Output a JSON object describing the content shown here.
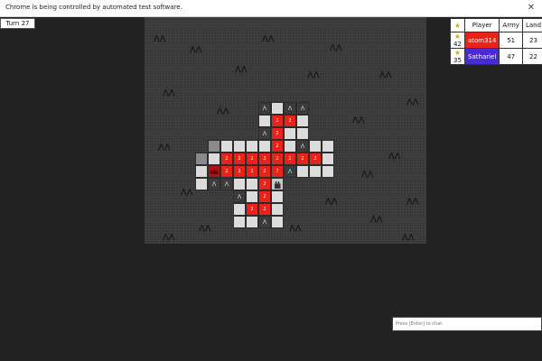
{
  "infobar": {
    "message": "Chrome is being controlled by automated test software.",
    "close_glyph": "✕"
  },
  "game": {
    "turn": "Turn 27",
    "board": {
      "colors": {
        "red": "#ea2218",
        "neutral": "#dcdcdc",
        "fog": "#3a3a3a",
        "general": "#b51010"
      },
      "tiles": [
        {
          "col": 5,
          "row": 0,
          "type": "mountain"
        },
        {
          "col": 6,
          "row": 0,
          "type": "neutral"
        },
        {
          "col": 7,
          "row": 0,
          "type": "mountain"
        },
        {
          "col": 8,
          "row": 0,
          "type": "mountain"
        },
        {
          "col": 5,
          "row": 1,
          "type": "neutral"
        },
        {
          "col": 6,
          "row": 1,
          "type": "red",
          "army": "2"
        },
        {
          "col": 7,
          "row": 1,
          "type": "red",
          "army": "2"
        },
        {
          "col": 8,
          "row": 1,
          "type": "neutral"
        },
        {
          "col": 5,
          "row": 2,
          "type": "mountain"
        },
        {
          "col": 6,
          "row": 2,
          "type": "red",
          "army": "2"
        },
        {
          "col": 7,
          "row": 2,
          "type": "neutral"
        },
        {
          "col": 8,
          "row": 2,
          "type": "neutral"
        },
        {
          "col": 1,
          "row": 3,
          "type": "dark"
        },
        {
          "col": 2,
          "row": 3,
          "type": "neutral"
        },
        {
          "col": 3,
          "row": 3,
          "type": "neutral"
        },
        {
          "col": 4,
          "row": 3,
          "type": "neutral"
        },
        {
          "col": 5,
          "row": 3,
          "type": "neutral"
        },
        {
          "col": 6,
          "row": 3,
          "type": "red",
          "army": "2"
        },
        {
          "col": 7,
          "row": 3,
          "type": "neutral"
        },
        {
          "col": 8,
          "row": 3,
          "type": "mountain"
        },
        {
          "col": 9,
          "row": 3,
          "type": "neutral"
        },
        {
          "col": 10,
          "row": 3,
          "type": "neutral"
        },
        {
          "col": 0,
          "row": 4,
          "type": "dark"
        },
        {
          "col": 1,
          "row": 4,
          "type": "neutral"
        },
        {
          "col": 2,
          "row": 4,
          "type": "red",
          "army": "2"
        },
        {
          "col": 3,
          "row": 4,
          "type": "red",
          "army": "2"
        },
        {
          "col": 4,
          "row": 4,
          "type": "red",
          "army": "2"
        },
        {
          "col": 5,
          "row": 4,
          "type": "red",
          "army": "2"
        },
        {
          "col": 6,
          "row": 4,
          "type": "red",
          "army": "2"
        },
        {
          "col": 7,
          "row": 4,
          "type": "red",
          "army": "2"
        },
        {
          "col": 8,
          "row": 4,
          "type": "red",
          "army": "2"
        },
        {
          "col": 9,
          "row": 4,
          "type": "red",
          "army": "2"
        },
        {
          "col": 10,
          "row": 4,
          "type": "neutral"
        },
        {
          "col": 0,
          "row": 5,
          "type": "neutral"
        },
        {
          "col": 1,
          "row": 5,
          "type": "general"
        },
        {
          "col": 2,
          "row": 5,
          "type": "red",
          "army": "2"
        },
        {
          "col": 3,
          "row": 5,
          "type": "red",
          "army": "2"
        },
        {
          "col": 4,
          "row": 5,
          "type": "red",
          "army": "2"
        },
        {
          "col": 5,
          "row": 5,
          "type": "red",
          "army": "2"
        },
        {
          "col": 6,
          "row": 5,
          "type": "red",
          "army": "7"
        },
        {
          "col": 7,
          "row": 5,
          "type": "mountain"
        },
        {
          "col": 8,
          "row": 5,
          "type": "neutral"
        },
        {
          "col": 9,
          "row": 5,
          "type": "neutral"
        },
        {
          "col": 10,
          "row": 5,
          "type": "neutral"
        },
        {
          "col": 0,
          "row": 6,
          "type": "neutral"
        },
        {
          "col": 1,
          "row": 6,
          "type": "mountain"
        },
        {
          "col": 2,
          "row": 6,
          "type": "mountain"
        },
        {
          "col": 3,
          "row": 6,
          "type": "neutral"
        },
        {
          "col": 4,
          "row": 6,
          "type": "neutral"
        },
        {
          "col": 5,
          "row": 6,
          "type": "red",
          "army": "2"
        },
        {
          "col": 6,
          "row": 6,
          "type": "city"
        },
        {
          "col": 3,
          "row": 7,
          "type": "mountain"
        },
        {
          "col": 4,
          "row": 7,
          "type": "neutral"
        },
        {
          "col": 5,
          "row": 7,
          "type": "red",
          "army": "2"
        },
        {
          "col": 6,
          "row": 7,
          "type": "neutral"
        },
        {
          "col": 3,
          "row": 8,
          "type": "neutral"
        },
        {
          "col": 4,
          "row": 8,
          "type": "red",
          "army": "2"
        },
        {
          "col": 5,
          "row": 8,
          "type": "red",
          "army": "2"
        },
        {
          "col": 6,
          "row": 8,
          "type": "neutral"
        },
        {
          "col": 3,
          "row": 9,
          "type": "neutral"
        },
        {
          "col": 4,
          "row": 9,
          "type": "neutral"
        },
        {
          "col": 5,
          "row": 9,
          "type": "mountain"
        },
        {
          "col": 6,
          "row": 9,
          "type": "neutral"
        }
      ]
    }
  },
  "leaderboard": {
    "headers": [
      "Player",
      "Army",
      "Land"
    ],
    "rows": [
      {
        "stars": "42",
        "player": "atom314",
        "army": "51",
        "land": "23",
        "color": "#ea2218"
      },
      {
        "stars": "35",
        "player": "Sathariel",
        "army": "47",
        "land": "22",
        "color": "#4a2ad6"
      }
    ]
  },
  "chat": {
    "placeholder": "Press [Enter] to chat."
  }
}
